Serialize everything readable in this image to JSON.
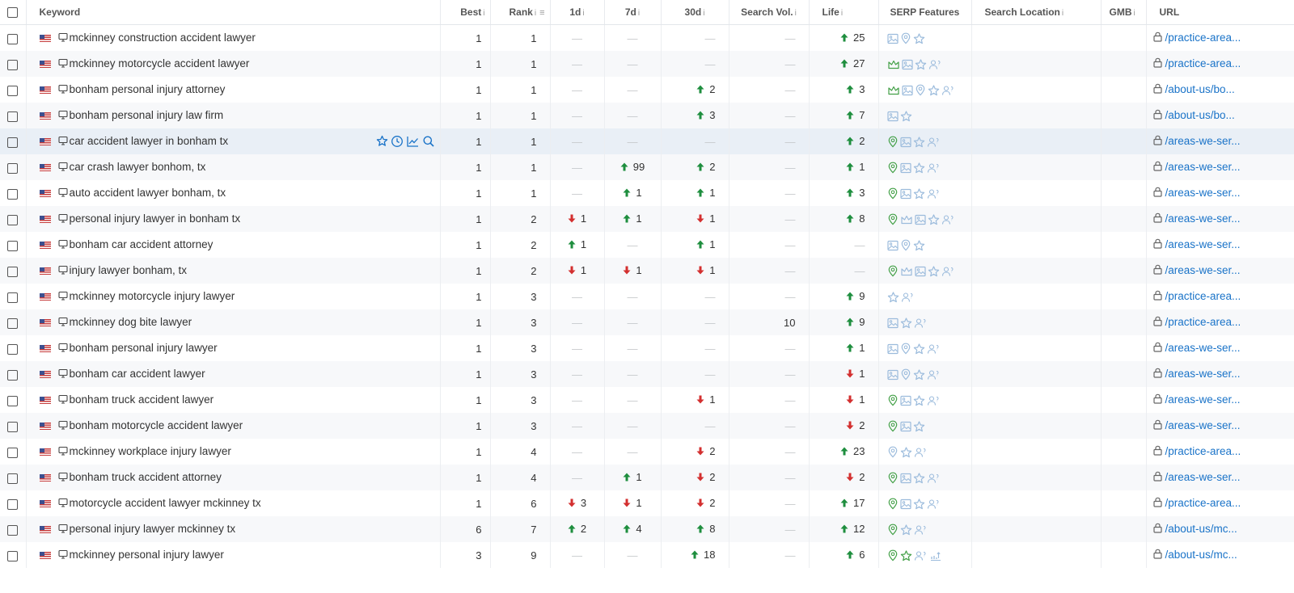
{
  "columns": {
    "keyword": "Keyword",
    "best": "Best",
    "rank": "Rank",
    "d1": "1d",
    "d7": "7d",
    "d30": "30d",
    "search_vol": "Search Vol.",
    "life": "Life",
    "serp": "SERP Features",
    "location": "Search Location",
    "gmb": "GMB",
    "url": "URL",
    "info_glyph": "i",
    "dash": "—"
  },
  "colors": {
    "up": "#1e8e3e",
    "down": "#d32f2f",
    "link": "#1a73c8",
    "serp_green": "#43a047",
    "serp_blue": "#9bbbdc"
  },
  "rows": [
    {
      "keyword": "mckinney construction accident lawyer",
      "best": "1",
      "rank": "1",
      "d1": null,
      "d7": null,
      "d30": null,
      "vol": null,
      "life": {
        "dir": "up",
        "val": "25"
      },
      "serp": [
        "image",
        "pin",
        "star"
      ],
      "url": "/practice-area..."
    },
    {
      "keyword": "mckinney motorcycle accident lawyer",
      "best": "1",
      "rank": "1",
      "d1": null,
      "d7": null,
      "d30": null,
      "vol": null,
      "life": {
        "dir": "up",
        "val": "27"
      },
      "serp": [
        "crown-g",
        "image",
        "star",
        "people"
      ],
      "url": "/practice-area..."
    },
    {
      "keyword": "bonham personal injury attorney",
      "best": "1",
      "rank": "1",
      "d1": null,
      "d7": null,
      "d30": {
        "dir": "up",
        "val": "2"
      },
      "vol": null,
      "life": {
        "dir": "up",
        "val": "3"
      },
      "serp": [
        "crown-g",
        "image",
        "pin",
        "star",
        "people"
      ],
      "url": "/about-us/bo..."
    },
    {
      "keyword": "bonham personal injury law firm",
      "best": "1",
      "rank": "1",
      "d1": null,
      "d7": null,
      "d30": {
        "dir": "up",
        "val": "3"
      },
      "vol": null,
      "life": {
        "dir": "up",
        "val": "7"
      },
      "serp": [
        "image",
        "star"
      ],
      "url": "/about-us/bo..."
    },
    {
      "keyword": "car accident lawyer in bonham tx",
      "best": "1",
      "rank": "1",
      "d1": null,
      "d7": null,
      "d30": null,
      "vol": null,
      "life": {
        "dir": "up",
        "val": "2"
      },
      "serp": [
        "pin-g",
        "image",
        "star",
        "people"
      ],
      "url": "/areas-we-ser...",
      "hover": true
    },
    {
      "keyword": "car crash lawyer bonhom, tx",
      "best": "1",
      "rank": "1",
      "d1": null,
      "d7": {
        "dir": "up",
        "val": "99"
      },
      "d30": {
        "dir": "up",
        "val": "2"
      },
      "vol": null,
      "life": {
        "dir": "up",
        "val": "1"
      },
      "serp": [
        "pin-g",
        "image",
        "star",
        "people"
      ],
      "url": "/areas-we-ser..."
    },
    {
      "keyword": "auto accident lawyer bonham, tx",
      "best": "1",
      "rank": "1",
      "d1": null,
      "d7": {
        "dir": "up",
        "val": "1"
      },
      "d30": {
        "dir": "up",
        "val": "1"
      },
      "vol": null,
      "life": {
        "dir": "up",
        "val": "3"
      },
      "serp": [
        "pin-g",
        "image",
        "star",
        "people"
      ],
      "url": "/areas-we-ser..."
    },
    {
      "keyword": "personal injury lawyer in bonham tx",
      "best": "1",
      "rank": "2",
      "d1": {
        "dir": "down",
        "val": "1"
      },
      "d7": {
        "dir": "up",
        "val": "1"
      },
      "d30": {
        "dir": "down",
        "val": "1"
      },
      "vol": null,
      "life": {
        "dir": "up",
        "val": "8"
      },
      "serp": [
        "pin-g",
        "crown",
        "image",
        "star",
        "people"
      ],
      "url": "/areas-we-ser..."
    },
    {
      "keyword": "bonham car accident attorney",
      "best": "1",
      "rank": "2",
      "d1": {
        "dir": "up",
        "val": "1"
      },
      "d7": null,
      "d30": {
        "dir": "up",
        "val": "1"
      },
      "vol": null,
      "life": null,
      "serp": [
        "image",
        "pin",
        "star"
      ],
      "url": "/areas-we-ser..."
    },
    {
      "keyword": "injury lawyer bonham, tx",
      "best": "1",
      "rank": "2",
      "d1": {
        "dir": "down",
        "val": "1"
      },
      "d7": {
        "dir": "down",
        "val": "1"
      },
      "d30": {
        "dir": "down",
        "val": "1"
      },
      "vol": null,
      "life": null,
      "serp": [
        "pin-g",
        "crown",
        "image",
        "star",
        "people"
      ],
      "url": "/areas-we-ser..."
    },
    {
      "keyword": "mckinney motorcycle injury lawyer",
      "best": "1",
      "rank": "3",
      "d1": null,
      "d7": null,
      "d30": null,
      "vol": null,
      "life": {
        "dir": "up",
        "val": "9"
      },
      "serp": [
        "star",
        "people"
      ],
      "url": "/practice-area..."
    },
    {
      "keyword": "mckinney dog bite lawyer",
      "best": "1",
      "rank": "3",
      "d1": null,
      "d7": null,
      "d30": null,
      "vol": "10",
      "life": {
        "dir": "up",
        "val": "9"
      },
      "serp": [
        "image",
        "star",
        "people"
      ],
      "url": "/practice-area..."
    },
    {
      "keyword": "bonham personal injury lawyer",
      "best": "1",
      "rank": "3",
      "d1": null,
      "d7": null,
      "d30": null,
      "vol": null,
      "life": {
        "dir": "up",
        "val": "1"
      },
      "serp": [
        "image",
        "pin",
        "star",
        "people"
      ],
      "url": "/areas-we-ser..."
    },
    {
      "keyword": "bonham car accident lawyer",
      "best": "1",
      "rank": "3",
      "d1": null,
      "d7": null,
      "d30": null,
      "vol": null,
      "life": {
        "dir": "down",
        "val": "1"
      },
      "serp": [
        "image",
        "pin",
        "star",
        "people"
      ],
      "url": "/areas-we-ser..."
    },
    {
      "keyword": "bonham truck accident lawyer",
      "best": "1",
      "rank": "3",
      "d1": null,
      "d7": null,
      "d30": {
        "dir": "down",
        "val": "1"
      },
      "vol": null,
      "life": {
        "dir": "down",
        "val": "1"
      },
      "serp": [
        "pin-g",
        "image",
        "star",
        "people"
      ],
      "url": "/areas-we-ser..."
    },
    {
      "keyword": "bonham motorcycle accident lawyer",
      "best": "1",
      "rank": "3",
      "d1": null,
      "d7": null,
      "d30": null,
      "vol": null,
      "life": {
        "dir": "down",
        "val": "2"
      },
      "serp": [
        "pin-g",
        "image",
        "star"
      ],
      "url": "/areas-we-ser..."
    },
    {
      "keyword": "mckinney workplace injury lawyer",
      "best": "1",
      "rank": "4",
      "d1": null,
      "d7": null,
      "d30": {
        "dir": "down",
        "val": "2"
      },
      "vol": null,
      "life": {
        "dir": "up",
        "val": "23"
      },
      "serp": [
        "pin",
        "star",
        "people"
      ],
      "url": "/practice-area..."
    },
    {
      "keyword": "bonham truck accident attorney",
      "best": "1",
      "rank": "4",
      "d1": null,
      "d7": {
        "dir": "up",
        "val": "1"
      },
      "d30": {
        "dir": "down",
        "val": "2"
      },
      "vol": null,
      "life": {
        "dir": "down",
        "val": "2"
      },
      "serp": [
        "pin-g",
        "image",
        "star",
        "people"
      ],
      "url": "/areas-we-ser..."
    },
    {
      "keyword": "motorcycle accident lawyer mckinney tx",
      "best": "1",
      "rank": "6",
      "d1": {
        "dir": "down",
        "val": "3"
      },
      "d7": {
        "dir": "down",
        "val": "1"
      },
      "d30": {
        "dir": "down",
        "val": "2"
      },
      "vol": null,
      "life": {
        "dir": "up",
        "val": "17"
      },
      "serp": [
        "pin-g",
        "image",
        "star",
        "people"
      ],
      "url": "/practice-area..."
    },
    {
      "keyword": "personal injury lawyer mckinney tx",
      "best": "6",
      "rank": "7",
      "d1": {
        "dir": "up",
        "val": "2"
      },
      "d7": {
        "dir": "up",
        "val": "4"
      },
      "d30": {
        "dir": "up",
        "val": "8"
      },
      "vol": null,
      "life": {
        "dir": "up",
        "val": "12"
      },
      "serp": [
        "pin-g",
        "star",
        "people"
      ],
      "url": "/about-us/mc..."
    },
    {
      "keyword": "mckinney personal injury lawyer",
      "best": "3",
      "rank": "9",
      "d1": null,
      "d7": null,
      "d30": {
        "dir": "up",
        "val": "18"
      },
      "vol": null,
      "life": {
        "dir": "up",
        "val": "6"
      },
      "serp": [
        "pin-g",
        "star-g",
        "people",
        "chart"
      ],
      "url": "/about-us/mc..."
    }
  ]
}
